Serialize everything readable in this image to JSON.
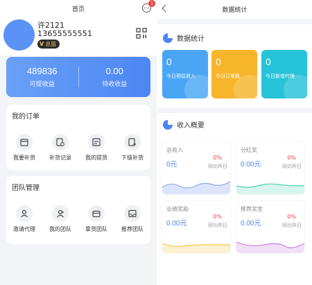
{
  "left": {
    "header_title": "首页",
    "badge_count": "1",
    "user": {
      "name": "许2121",
      "phone": "13655555551",
      "role": "总监"
    },
    "earnings": [
      {
        "value": "489836",
        "label": "可提收益"
      },
      {
        "value": "0.00",
        "label": "待收收益"
      }
    ],
    "orders": {
      "title": "我的订单",
      "items": [
        {
          "label": "我要补货",
          "icon": "calendar-icon"
        },
        {
          "label": "补货记录",
          "icon": "record-icon"
        },
        {
          "label": "我的提货",
          "icon": "pickup-icon"
        },
        {
          "label": "下级补货",
          "icon": "add-calendar-icon"
        }
      ]
    },
    "team": {
      "title": "团队管理",
      "items": [
        {
          "label": "邀请代理",
          "icon": "person-icon"
        },
        {
          "label": "我的团队",
          "icon": "team-icon"
        },
        {
          "label": "拿货团队",
          "icon": "wallet-icon"
        },
        {
          "label": "推荐团队",
          "icon": "inbox-icon"
        }
      ]
    }
  },
  "right": {
    "header_title": "数据统计",
    "stats_title": "数据统计",
    "tiles": [
      {
        "value": "0",
        "label": "今日预估收入",
        "color": "#4aa6f5",
        "icon": "yen-icon"
      },
      {
        "value": "0",
        "label": "今日订单数",
        "color": "#f7b52b",
        "icon": "clipboard-icon"
      },
      {
        "value": "0",
        "label": "今日新增代理",
        "color": "#27c3d8",
        "icon": "star-icon"
      }
    ],
    "overview_title": "收入概要",
    "minis": [
      {
        "title": "总收入",
        "value": "0元",
        "percent": "0%",
        "compare": "同比昨日",
        "color": "#8ea8f0"
      },
      {
        "title": "分红奖",
        "value": "0.00元",
        "percent": "0%",
        "compare": "同比昨日",
        "color": "#4fd1b0"
      },
      {
        "title": "业绩奖励",
        "value": "0.00元",
        "percent": "0%",
        "compare": "同比昨日",
        "color": "#f5c64a"
      },
      {
        "title": "推荐奖金",
        "value": "0.00元",
        "percent": "0%",
        "compare": "同比昨日",
        "color": "#c781e0"
      }
    ]
  }
}
